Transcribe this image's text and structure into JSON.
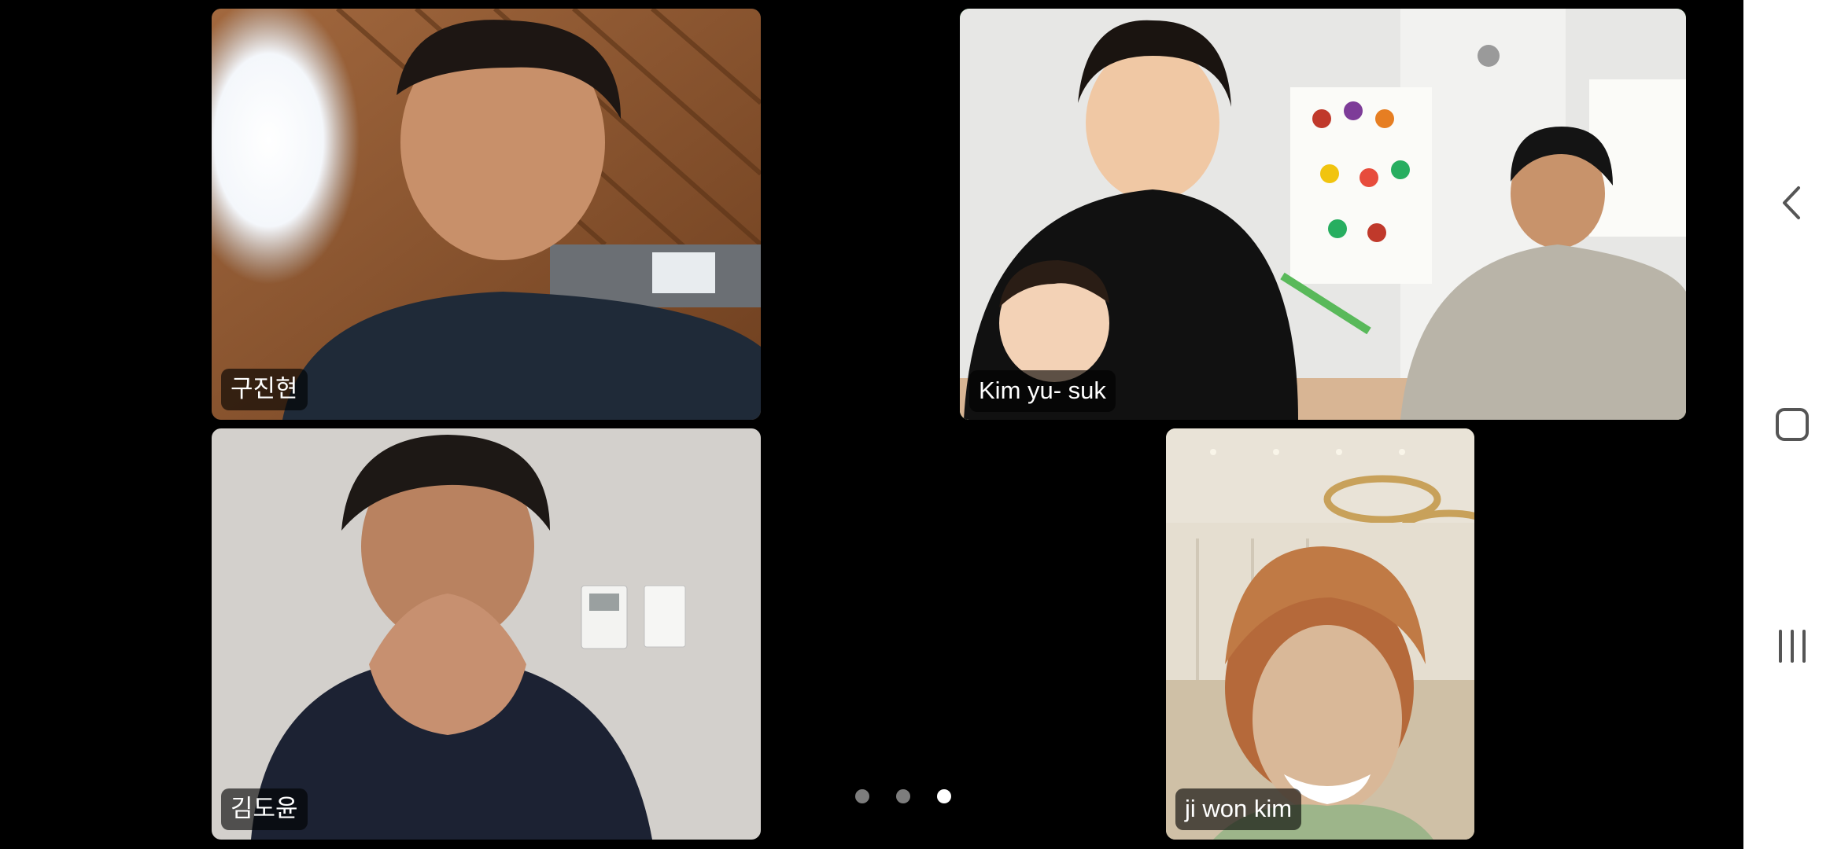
{
  "participants": [
    {
      "name": "구진현",
      "active": false
    },
    {
      "name": "Kim yu- suk",
      "active": true
    },
    {
      "name": "김도윤",
      "active": false
    },
    {
      "name": "ji won kim",
      "active": false
    }
  ],
  "pager": {
    "total": 3,
    "current": 3
  },
  "navbar": {
    "back": "back-icon",
    "home": "home-icon",
    "recents": "recents-icon"
  },
  "colors": {
    "active_border": "#2ecc40",
    "background": "#000000",
    "navbar": "#ffffff"
  }
}
